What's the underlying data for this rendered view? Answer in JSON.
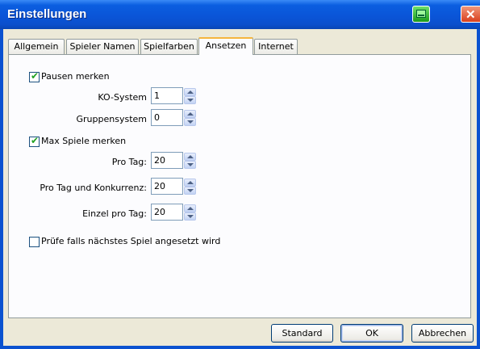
{
  "window": {
    "title": "Einstellungen"
  },
  "tabs": [
    {
      "label": "Allgemein"
    },
    {
      "label": "Spieler Namen"
    },
    {
      "label": "Spielfarben"
    },
    {
      "label": "Ansetzen",
      "active": true
    },
    {
      "label": "Internet"
    }
  ],
  "ansetzen": {
    "pausen_merken": {
      "label": "Pausen merken",
      "checked": true
    },
    "ko_system": {
      "label": "KO-System",
      "value": "1"
    },
    "gruppensystem": {
      "label": "Gruppensystem",
      "value": "0"
    },
    "max_spiele_merken": {
      "label": "Max Spiele merken",
      "checked": true
    },
    "pro_tag": {
      "label": "Pro Tag:",
      "value": "20"
    },
    "pro_tag_konkurrenz": {
      "label": "Pro Tag und Konkurrenz:",
      "value": "20"
    },
    "einzel_pro_tag": {
      "label": "Einzel pro Tag:",
      "value": "20"
    },
    "pruefe_naechstes": {
      "label": "Prüfe falls nächstes Spiel angesetzt wird",
      "checked": false
    }
  },
  "buttons": {
    "standard": "Standard",
    "ok": "OK",
    "abbrechen": "Abbrechen"
  },
  "check_mark": "✔",
  "colors": {
    "titlebar": "#0a55d8",
    "tab_highlight": "#f5b53e",
    "dialog_bg": "#ece9d8"
  }
}
